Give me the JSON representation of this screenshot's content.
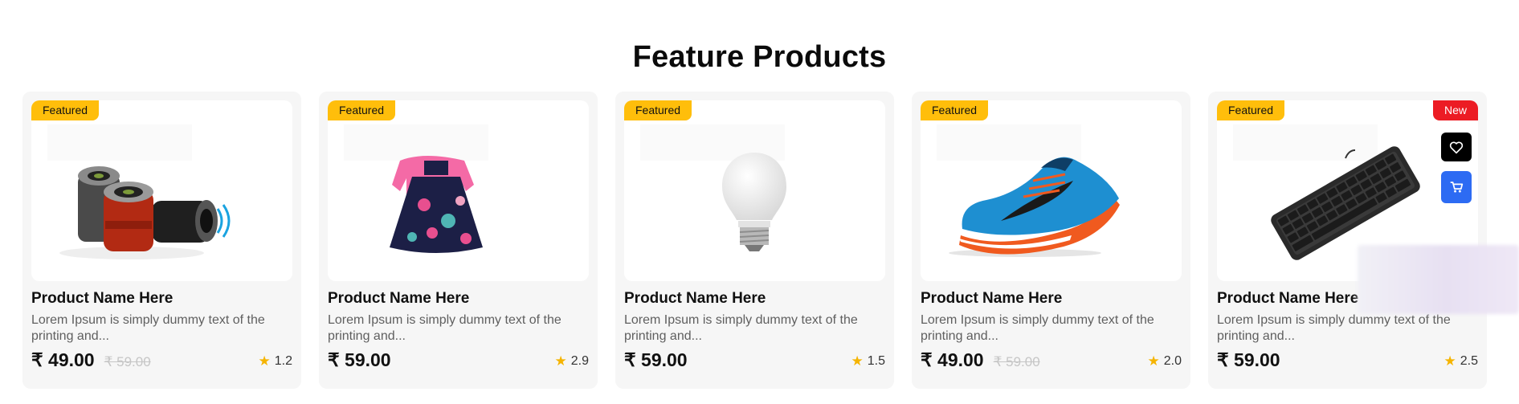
{
  "section": {
    "title": "Feature Products"
  },
  "products": [
    {
      "badge": "Featured",
      "new_badge": "",
      "name": "Product Name Here",
      "description": "Lorem Ipsum is simply dummy text of the printing and...",
      "price": "₹ 49.00",
      "old_price": "₹ 59.00",
      "rating": "1.2",
      "image": "bluetooth-speakers"
    },
    {
      "badge": "Featured",
      "new_badge": "",
      "name": "Product Name Here",
      "description": "Lorem Ipsum is simply dummy text of the printing and...",
      "price": "₹ 59.00",
      "old_price": "",
      "rating": "2.9",
      "image": "baby-dress"
    },
    {
      "badge": "Featured",
      "new_badge": "",
      "name": "Product Name Here",
      "description": "Lorem Ipsum is simply dummy text of the printing and...",
      "price": "₹ 59.00",
      "old_price": "",
      "rating": "1.5",
      "image": "light-bulb"
    },
    {
      "badge": "Featured",
      "new_badge": "",
      "name": "Product Name Here",
      "description": "Lorem Ipsum is simply dummy text of the printing and...",
      "price": "₹ 49.00",
      "old_price": "₹ 59.00",
      "rating": "2.0",
      "image": "running-shoe"
    },
    {
      "badge": "Featured",
      "new_badge": "New",
      "name": "Product Name Here",
      "description": "Lorem Ipsum is simply dummy text of the printing and...",
      "price": "₹ 59.00",
      "old_price": "",
      "rating": "2.5",
      "image": "keyboard"
    }
  ],
  "icons": {
    "star": "star-icon",
    "wishlist": "heart-icon",
    "cart": "cart-icon"
  },
  "colors": {
    "featured_badge": "#ffbe0b",
    "new_badge": "#ec1c24",
    "cart_button": "#2d6bf3",
    "star": "#f5b400"
  }
}
